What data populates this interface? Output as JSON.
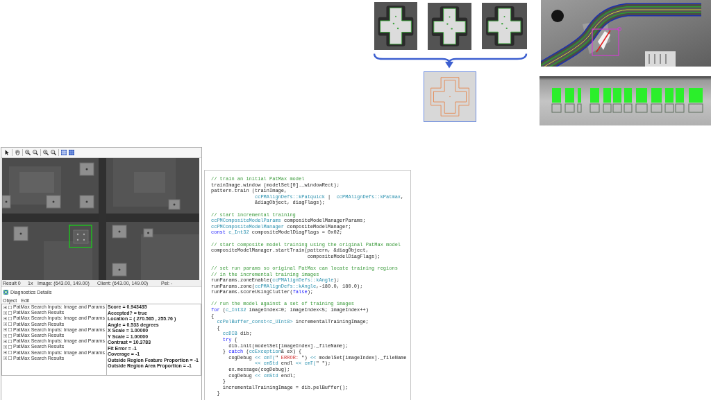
{
  "viewer_window": {
    "status_bar": [
      "Result 0",
      "1x",
      "Image: (643.00, 149.00)",
      "Client: (643.00, 149.00)",
      "Pel: -"
    ],
    "diagnostics": {
      "title": "Diagnostics Details",
      "menu": [
        "Object",
        "Edit"
      ],
      "tree": [
        {
          "label": "PatMax Search Inputs: Image and Params",
          "expanded": false,
          "checked": false
        },
        {
          "label": "PatMax Search Results",
          "expanded": false,
          "checked": false
        },
        {
          "label": "PatMax Search Inputs: Image and Params",
          "expanded": false,
          "checked": false
        },
        {
          "label": "PatMax Search Results",
          "expanded": false,
          "checked": false
        },
        {
          "label": "PatMax Search Inputs: Image and Params",
          "expanded": false,
          "checked": false
        },
        {
          "label": "PatMax Search Results",
          "expanded": false,
          "checked": false
        },
        {
          "label": "PatMax Search Inputs: Image and Params",
          "expanded": false,
          "checked": false
        },
        {
          "label": "PatMax Search Results",
          "expanded": false,
          "checked": false
        },
        {
          "label": "PatMax Search Inputs: Image and Params",
          "expanded": false,
          "checked": false
        },
        {
          "label": "PatMax Search Results",
          "expanded": false,
          "checked": false
        }
      ],
      "details": [
        "Score = 0.943435",
        "Accepted? = true",
        "Location = ( 270.565 , 255.76 )",
        "Angle = 0.533 degrees",
        "X Scale = 1.00000",
        "Y Scale = 1.00000",
        "Contrast = 10.3783",
        "Fit Error = -1",
        "Coverage = -1",
        "Outside Region Feature Proportion = -1",
        "Outside Region Area Proportion = -1"
      ]
    }
  },
  "code_panel": {
    "blocks": [
      [
        [
          {
            "kind": "comment",
            "text": "// train an initial PatMax model"
          }
        ],
        [
          {
            "kind": "plain",
            "text": "trainImage.window (modelSet[0]._windowRect);"
          }
        ],
        [
          {
            "kind": "plain",
            "text": "pattern.train (trainImage,"
          }
        ],
        [
          {
            "kind": "type",
            "text": "               ccPMAlignDefs::kPatquick"
          },
          {
            "kind": "plain",
            "text": " |  "
          },
          {
            "kind": "type",
            "text": "ccPMAlignDefs::kPatmax"
          },
          {
            "kind": "plain",
            "text": ","
          }
        ],
        [
          {
            "kind": "plain",
            "text": "               &diagObject, diagFlags);"
          }
        ]
      ],
      [
        [
          {
            "kind": "comment",
            "text": "// start incremental training"
          }
        ],
        [
          {
            "kind": "type",
            "text": "ccPMCompositeModelParams"
          },
          {
            "kind": "plain",
            "text": " compositeModelManagerParams;"
          }
        ],
        [
          {
            "kind": "type",
            "text": "ccPMCompositeModelManager"
          },
          {
            "kind": "plain",
            "text": " compositeModelManager;"
          }
        ],
        [
          {
            "kind": "keyword",
            "text": "const "
          },
          {
            "kind": "type",
            "text": "c_Int32"
          },
          {
            "kind": "plain",
            "text": " compositeModelDiagFlags = 0x02;"
          }
        ]
      ],
      [
        [
          {
            "kind": "comment",
            "text": "// start composite model training using the original PatMax model"
          }
        ],
        [
          {
            "kind": "plain",
            "text": "compositeModelManager.startTrain(pattern, &diagObject,"
          }
        ],
        [
          {
            "kind": "plain",
            "text": "                                 compositeModelDiagFlags);"
          }
        ]
      ],
      [
        [
          {
            "kind": "comment",
            "text": "// set run params so original PatMax can locate training regions"
          }
        ],
        [
          {
            "kind": "comment",
            "text": "// in the incremental training images"
          }
        ],
        [
          {
            "kind": "plain",
            "text": "runParams.zoneEnable("
          },
          {
            "kind": "type",
            "text": "ccPMAlignDefs::kAngle"
          },
          {
            "kind": "plain",
            "text": ");"
          }
        ],
        [
          {
            "kind": "plain",
            "text": "runParams.zone("
          },
          {
            "kind": "type",
            "text": "ccPMAlignDefs::kAngle"
          },
          {
            "kind": "plain",
            "text": ",-180.0, 180.0);"
          }
        ],
        [
          {
            "kind": "plain",
            "text": "runParams.scoreUsingClutter("
          },
          {
            "kind": "keyword",
            "text": "false"
          },
          {
            "kind": "plain",
            "text": ");"
          }
        ]
      ],
      [
        [
          {
            "kind": "comment",
            "text": "// run the model against a set of training images"
          }
        ],
        [
          {
            "kind": "keyword",
            "text": "for"
          },
          {
            "kind": "plain",
            "text": " ("
          },
          {
            "kind": "type",
            "text": "c_Int32"
          },
          {
            "kind": "plain",
            "text": " imageIndex=0; imageIndex<5; imageIndex++)"
          }
        ],
        [
          {
            "kind": "plain",
            "text": "{"
          }
        ],
        [
          {
            "kind": "type",
            "text": "  ccPelBuffer_const<c_UInt8>"
          },
          {
            "kind": "plain",
            "text": " incrementalTrainingImage;"
          }
        ],
        [
          {
            "kind": "plain",
            "text": "  {"
          }
        ],
        [
          {
            "kind": "type",
            "text": "    ccDIB"
          },
          {
            "kind": "plain",
            "text": " dib;"
          }
        ],
        [
          {
            "kind": "keyword",
            "text": "    try"
          },
          {
            "kind": "plain",
            "text": " {"
          }
        ],
        [
          {
            "kind": "plain",
            "text": "      dib.init(modelSet[imageIndex]._fileName);"
          }
        ],
        [
          {
            "kind": "plain",
            "text": "    } "
          },
          {
            "kind": "keyword",
            "text": "catch"
          },
          {
            "kind": "plain",
            "text": " ("
          },
          {
            "kind": "type",
            "text": "ccException"
          },
          {
            "kind": "plain",
            "text": "& ex) {"
          }
        ],
        [
          {
            "kind": "plain",
            "text": "      cogDebug "
          },
          {
            "kind": "type",
            "text": "<< cmT("
          },
          {
            "kind": "plain",
            "text": "\" "
          },
          {
            "kind": "string",
            "text": "ERROR:"
          },
          {
            "kind": "plain",
            "text": " \") "
          },
          {
            "kind": "type",
            "text": "<<"
          },
          {
            "kind": "plain",
            "text": " modelSet[imageIndex]._fileName"
          }
        ],
        [
          {
            "kind": "type",
            "text": "               << cmStd"
          },
          {
            "kind": "plain",
            "text": " endl "
          },
          {
            "kind": "type",
            "text": "<< cmT("
          },
          {
            "kind": "plain",
            "text": "\" \");"
          }
        ],
        [
          {
            "kind": "plain",
            "text": "      ex.message(cogDebug);"
          }
        ],
        [
          {
            "kind": "plain",
            "text": "      cogDebug "
          },
          {
            "kind": "type",
            "text": "<< cmStd"
          },
          {
            "kind": "plain",
            "text": " endl;"
          }
        ],
        [
          {
            "kind": "plain",
            "text": "    }"
          }
        ],
        [
          {
            "kind": "plain",
            "text": "    incrementalTrainingImage = dib.pelBuffer();"
          }
        ],
        [
          {
            "kind": "plain",
            "text": "  }"
          }
        ]
      ]
    ]
  }
}
